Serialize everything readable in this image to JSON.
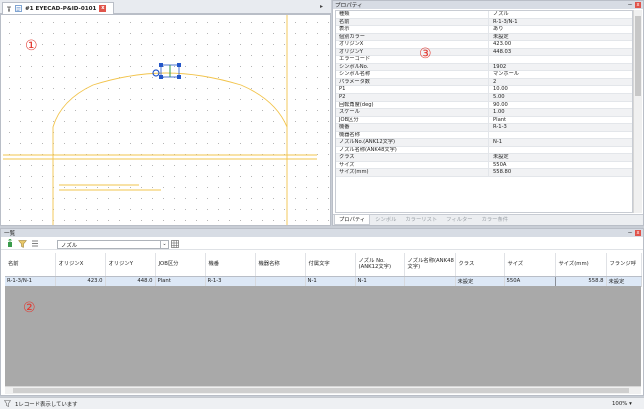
{
  "drawing": {
    "tab_label": "#1 EYECAD-P&ID-0101",
    "marker": "①"
  },
  "property_panel": {
    "title": "プロパティ",
    "marker": "③",
    "rows": [
      {
        "key": "種類",
        "value": "ノズル"
      },
      {
        "key": "名前",
        "value": "R-1-3/N-1"
      },
      {
        "key": "表示",
        "value": "あり"
      },
      {
        "key": "個別カラー",
        "value": "未設定"
      },
      {
        "key": "オリジンX",
        "value": "423.00"
      },
      {
        "key": "オリジンY",
        "value": "448.03"
      },
      {
        "key": "エラーコード",
        "value": ""
      },
      {
        "key": "シンボルNo.",
        "value": "1902"
      },
      {
        "key": "シンボル名称",
        "value": "マンホール"
      },
      {
        "key": "パラメータ数",
        "value": "2"
      },
      {
        "key": "P1",
        "value": "10.00"
      },
      {
        "key": "P2",
        "value": "5.00"
      },
      {
        "key": "回転角度(deg)",
        "value": "90.00"
      },
      {
        "key": "スケール",
        "value": "1.00"
      },
      {
        "key": "JOB区分",
        "value": "Plant"
      },
      {
        "key": "機番",
        "value": "R-1-3"
      },
      {
        "key": "機器名称",
        "value": ""
      },
      {
        "key": "ノズルNo.(ANK12文字)",
        "value": "N-1"
      },
      {
        "key": "ノズル名称(ANK48文字)",
        "value": ""
      },
      {
        "key": "クラス",
        "value": "未設定"
      },
      {
        "key": "サイズ",
        "value": "550A"
      },
      {
        "key": "サイズ(mm)",
        "value": "558.80"
      }
    ],
    "tabs": [
      "プロパティ",
      "シンボル",
      "カラーリスト",
      "フィルター",
      "カラー条件"
    ]
  },
  "list_panel": {
    "title": "一覧",
    "filter_value": "ノズル",
    "marker": "②",
    "columns": [
      "名前",
      "オリジンX",
      "オリジンY",
      "JOB区分",
      "機番",
      "機器名称",
      "付属文字",
      "ノズル No.(ANK12文字)",
      "ノズル名称(ANK48文字)",
      "クラス",
      "サイズ",
      "サイズ(mm)",
      "フランジ呼"
    ],
    "rows": [
      [
        "R-1-3/N-1",
        "423.0",
        "448.0",
        "Plant",
        "R-1-3",
        "",
        "N-1",
        "N-1",
        "",
        "未設定",
        "550A",
        "558.8",
        "未設定"
      ]
    ]
  },
  "status": {
    "text": "1レコード表示しています",
    "zoom": "100%"
  },
  "colors": {
    "drawing_line": "#f2c44c",
    "marker": "#e3372e",
    "selection_blue": "#2456c8"
  }
}
